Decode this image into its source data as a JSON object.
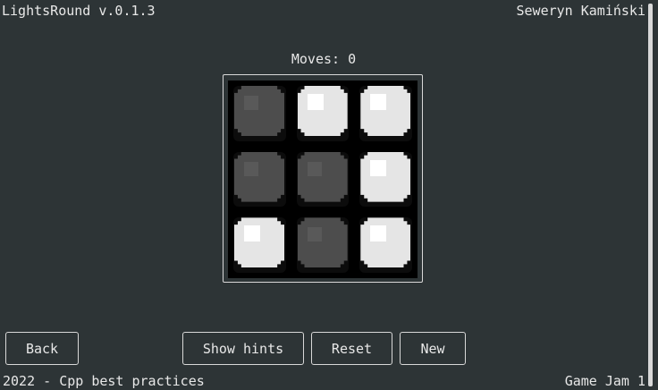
{
  "header": {
    "app_title": "LightsRound v.0.1.3",
    "author": "Seweryn Kamiński"
  },
  "game": {
    "moves_text": "Moves: 0",
    "board": [
      [
        false,
        true,
        true
      ],
      [
        false,
        false,
        true
      ],
      [
        true,
        false,
        true
      ]
    ]
  },
  "buttons": {
    "back": "Back",
    "show_hints": "Show hints",
    "reset": "Reset",
    "new": "New"
  },
  "footer": {
    "left": "2022 - Cpp best practices",
    "right": "Game Jam 1"
  },
  "colors": {
    "background": "#2d3436",
    "light_on": "#e5e5e5",
    "light_off": "#4d4d4d",
    "border": "#d8d8d8"
  }
}
